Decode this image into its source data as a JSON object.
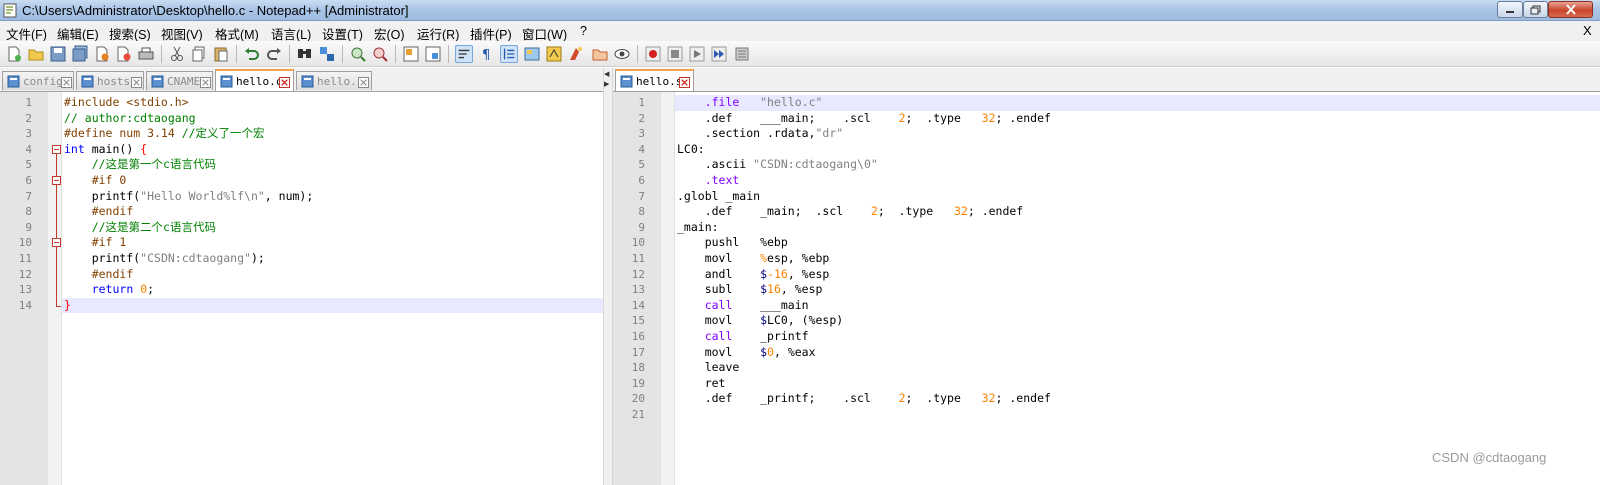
{
  "window": {
    "title": "C:\\Users\\Administrator\\Desktop\\hello.c - Notepad++ [Administrator]",
    "close_x": "X"
  },
  "menu": [
    "文件(F)",
    "编辑(E)",
    "搜索(S)",
    "视图(V)",
    "格式(M)",
    "语言(L)",
    "设置(T)",
    "宏(O)",
    "运行(R)",
    "插件(P)",
    "窗口(W)",
    "?"
  ],
  "toolbar": {
    "icons": [
      "new-file-icon",
      "open-file-icon",
      "save-icon",
      "save-all-icon",
      "close-icon",
      "close-all-icon",
      "print-icon",
      "cut-icon",
      "copy-icon",
      "paste-icon",
      "undo-icon",
      "redo-icon",
      "find-icon",
      "replace-icon",
      "zoom-in-icon",
      "zoom-out-icon",
      "sync-vertical-icon",
      "sync-horizontal-icon",
      "word-wrap-icon",
      "show-all-chars-icon",
      "indent-guide-icon",
      "doc-map-icon",
      "function-list-icon",
      "folder-workspace-icon",
      "monitor-icon",
      "record-macro-icon",
      "stop-macro-icon",
      "play-macro-icon",
      "run-macro-multiple-icon",
      "save-macro-icon"
    ]
  },
  "tabs_left": [
    {
      "label": "config",
      "active": false
    },
    {
      "label": "hosts",
      "active": false
    },
    {
      "label": "CNAME",
      "active": false
    },
    {
      "label": "hello.c",
      "active": true
    },
    {
      "label": "hello.i",
      "active": false
    }
  ],
  "tabs_right": [
    {
      "label": "hello.s",
      "active": true
    }
  ],
  "left_editor": {
    "file": "hello.c",
    "lines": [
      {
        "n": "1",
        "text": "#include <stdio.h>"
      },
      {
        "n": "2",
        "text": "// author:cdtaogang"
      },
      {
        "n": "3",
        "text": "#define num 3.14 //定义了一个宏"
      },
      {
        "n": "4",
        "text": "int main() {"
      },
      {
        "n": "5",
        "text": "    //这是第一个c语言代码"
      },
      {
        "n": "6",
        "text": "    #if 0"
      },
      {
        "n": "7",
        "text": "    printf(\"Hello World%lf\\n\", num);"
      },
      {
        "n": "8",
        "text": "    #endif"
      },
      {
        "n": "9",
        "text": "    //这是第二个c语言代码"
      },
      {
        "n": "10",
        "text": "    #if 1"
      },
      {
        "n": "11",
        "text": "    printf(\"CSDN:cdtaogang\");"
      },
      {
        "n": "12",
        "text": "    #endif"
      },
      {
        "n": "13",
        "text": "    return 0;"
      },
      {
        "n": "14",
        "text": "}"
      }
    ]
  },
  "right_editor": {
    "file": "hello.s",
    "lines": [
      {
        "n": "1",
        "text": "    .file   \"hello.c\""
      },
      {
        "n": "2",
        "text": "    .def    ___main;    .scl    2;  .type   32; .endef"
      },
      {
        "n": "3",
        "text": "    .section .rdata,\"dr\""
      },
      {
        "n": "4",
        "text": "LC0:"
      },
      {
        "n": "5",
        "text": "    .ascii \"CSDN:cdtaogang\\0\""
      },
      {
        "n": "6",
        "text": "    .text"
      },
      {
        "n": "7",
        "text": ".globl _main"
      },
      {
        "n": "8",
        "text": "    .def    _main;  .scl    2;  .type   32; .endef"
      },
      {
        "n": "9",
        "text": "_main:"
      },
      {
        "n": "10",
        "text": "    pushl   %ebp"
      },
      {
        "n": "11",
        "text": "    movl    %esp, %ebp"
      },
      {
        "n": "12",
        "text": "    andl    $-16, %esp"
      },
      {
        "n": "13",
        "text": "    subl    $16, %esp"
      },
      {
        "n": "14",
        "text": "    call    ___main"
      },
      {
        "n": "15",
        "text": "    movl    $LC0, (%esp)"
      },
      {
        "n": "16",
        "text": "    call    _printf"
      },
      {
        "n": "17",
        "text": "    movl    $0, %eax"
      },
      {
        "n": "18",
        "text": "    leave"
      },
      {
        "n": "19",
        "text": "    ret"
      },
      {
        "n": "20",
        "text": "    .def    _printf;    .scl    2;  .type   32; .endef"
      },
      {
        "n": "21",
        "text": ""
      }
    ]
  },
  "watermark": "CSDN @cdtaogang",
  "colors": {
    "preprocessor": "#804000",
    "comment": "#008000",
    "keyword": "#0000ff",
    "string": "#808080",
    "number": "#ff8000",
    "current_line": "#e8e8ff",
    "tab_active_accent": "#f4a54a"
  }
}
